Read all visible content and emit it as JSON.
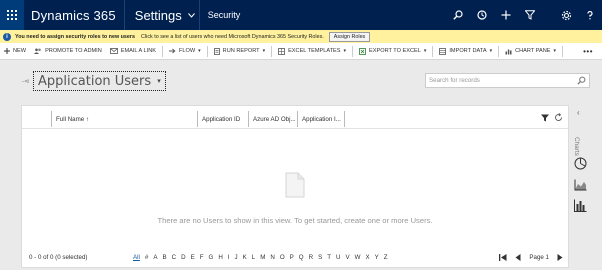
{
  "nav": {
    "app_title": "Dynamics 365",
    "settings_label": "Settings",
    "area_label": "Security",
    "icons": [
      "waffle-icon",
      "search-icon",
      "history-icon",
      "plus-icon",
      "filter-icon",
      "gear-icon",
      "help-icon"
    ]
  },
  "notification": {
    "bold_text": "You need to assign security roles to new users",
    "text": "Click to see a list of users who need Microsoft Dynamics 365 Security Roles.",
    "button_label": "Assign Roles"
  },
  "commands": {
    "new": "NEW",
    "promote": "PROMOTE TO ADMIN",
    "email_link": "EMAIL A LINK",
    "flow": "FLOW",
    "run_report": "RUN REPORT",
    "excel_templates": "EXCEL TEMPLATES",
    "export_excel": "EXPORT TO EXCEL",
    "import_data": "IMPORT DATA",
    "chart_pane": "CHART PANE",
    "more": "•••"
  },
  "view": {
    "title": "Application Users",
    "search_placeholder": "Search for records"
  },
  "grid": {
    "columns": [
      "Full Name ↑",
      "Application ID",
      "Azure AD Obj...",
      "Application I..."
    ],
    "empty_message": "There are no Users to show in this view. To get started, create one or more Users."
  },
  "footer": {
    "status": "0 - 0 of 0 (0 selected)",
    "letters": [
      "All",
      "#",
      "A",
      "B",
      "C",
      "D",
      "E",
      "F",
      "G",
      "H",
      "I",
      "J",
      "K",
      "L",
      "M",
      "N",
      "O",
      "P",
      "Q",
      "R",
      "S",
      "T",
      "U",
      "V",
      "W",
      "X",
      "Y",
      "Z"
    ],
    "page_label": "Page 1"
  },
  "charts": {
    "label": "Charts"
  },
  "colors": {
    "nav_bg": "#002050",
    "waffle_bg": "#003b7a",
    "notification_bg": "#fff19d",
    "link_blue": "#1a5aa3"
  }
}
